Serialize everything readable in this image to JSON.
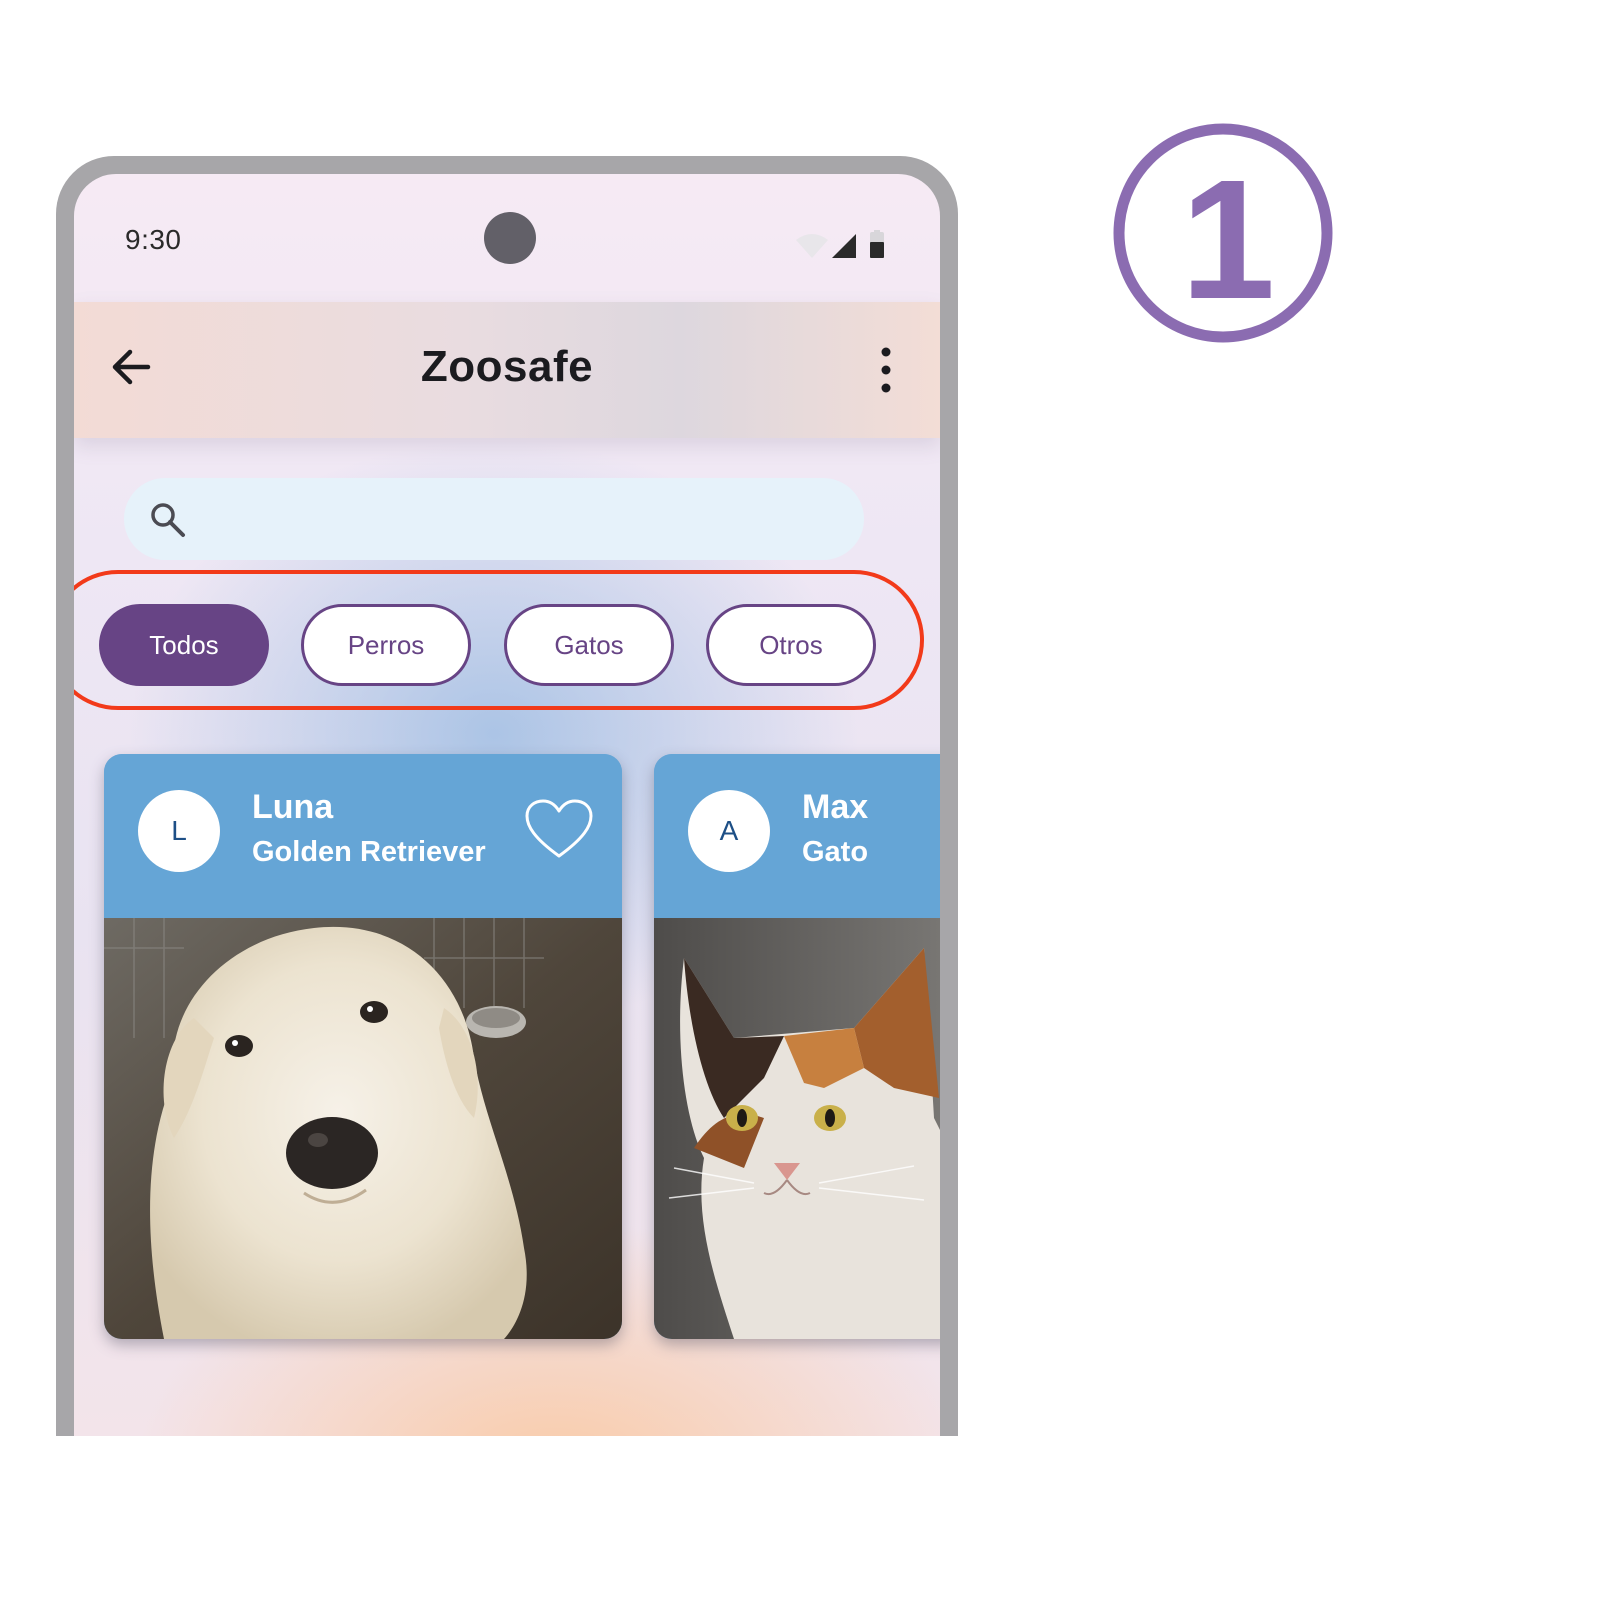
{
  "status_bar": {
    "time": "9:30"
  },
  "app_bar": {
    "title": "Zoosafe",
    "back_icon": "arrow-left-icon",
    "menu_icon": "more-vert-icon"
  },
  "search": {
    "placeholder": "",
    "icon": "search-icon"
  },
  "filters": [
    {
      "label": "Todos",
      "selected": true
    },
    {
      "label": "Perros",
      "selected": false
    },
    {
      "label": "Gatos",
      "selected": false
    },
    {
      "label": "Otros",
      "selected": false
    }
  ],
  "pets": [
    {
      "initial": "L",
      "name": "Luna",
      "breed": "Golden Retriever",
      "favorite_icon": "heart-outline-icon",
      "photo": "white dog"
    },
    {
      "initial": "A",
      "name": "Max",
      "breed": "Gato",
      "photo": "calico cat"
    }
  ],
  "annotation": {
    "step": "1",
    "color": "#8b6cb1"
  },
  "colors": {
    "primary": "#674485",
    "card": "#65a5d6",
    "highlight": "#f23a1a",
    "search_bg": "#e6f2fa"
  }
}
